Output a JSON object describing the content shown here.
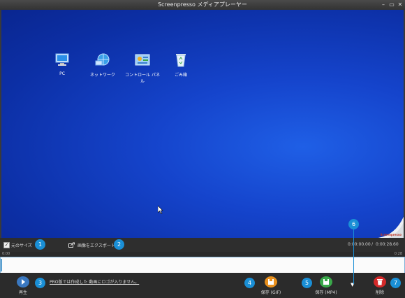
{
  "window": {
    "title": "Screenpresso メディアプレーヤー",
    "minimize_glyph": "–",
    "maximize_glyph": "▭",
    "close_glyph": "✕"
  },
  "desktop": {
    "icons": [
      {
        "label": "PC",
        "icon": "computer-icon"
      },
      {
        "label": "ネットワーク",
        "icon": "network-icon"
      },
      {
        "label": "コントロール パネル",
        "icon": "control-panel-icon"
      },
      {
        "label": "ごみ箱",
        "icon": "recycle-bin-icon"
      }
    ],
    "watermark": "Screenpresso"
  },
  "toolbar": {
    "original_size_checked": true,
    "original_size_check_glyph": "✓",
    "original_size_label": "元のサイズ",
    "export_image_label": "画像をエクスポート",
    "time_current": "0:00:00.00",
    "time_separator": "/",
    "time_total": "0:00:28.60"
  },
  "timeline": {
    "start_tick": "0:00",
    "end_tick": "0:28"
  },
  "actions": {
    "play_label": "再生",
    "promo_text": "PRO版では作成した 動画にロゴが入りません。",
    "save_gif_label": "保存 (GIF)",
    "save_mp4_label": "保存 (MP4)",
    "more_glyph": "▼",
    "delete_label": "削除"
  },
  "badges": [
    "1",
    "2",
    "3",
    "4",
    "5",
    "6",
    "7"
  ],
  "colors": {
    "badge": "#1a8fd6",
    "gif_button": "#e8901e",
    "mp4_button": "#3aa84a",
    "delete_button": "#d42a2a",
    "play_button": "#3a78c0"
  }
}
